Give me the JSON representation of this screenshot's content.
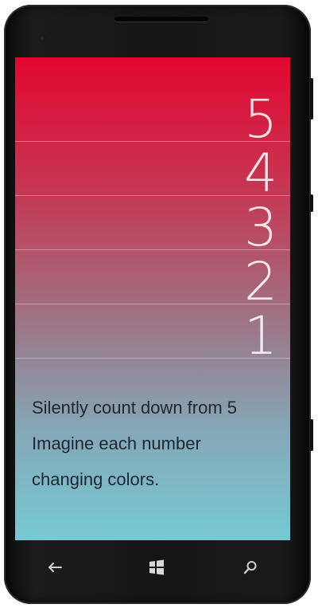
{
  "countdown": {
    "numbers": [
      "5",
      "4",
      "3",
      "2",
      "1"
    ]
  },
  "message": {
    "line1": "Silently count down from 5",
    "line2": "Imagine each number",
    "line3": "changing colors."
  },
  "colors": {
    "gradient_top": "#e3062f",
    "gradient_bottom": "#76c9d2",
    "text_dark": "#202733",
    "numbers": "#ffffff",
    "phone_body": "#151515"
  },
  "hardware_buttons": {
    "back_icon": "back-arrow-icon",
    "start_icon": "windows-logo-icon",
    "search_icon": "search-icon"
  }
}
